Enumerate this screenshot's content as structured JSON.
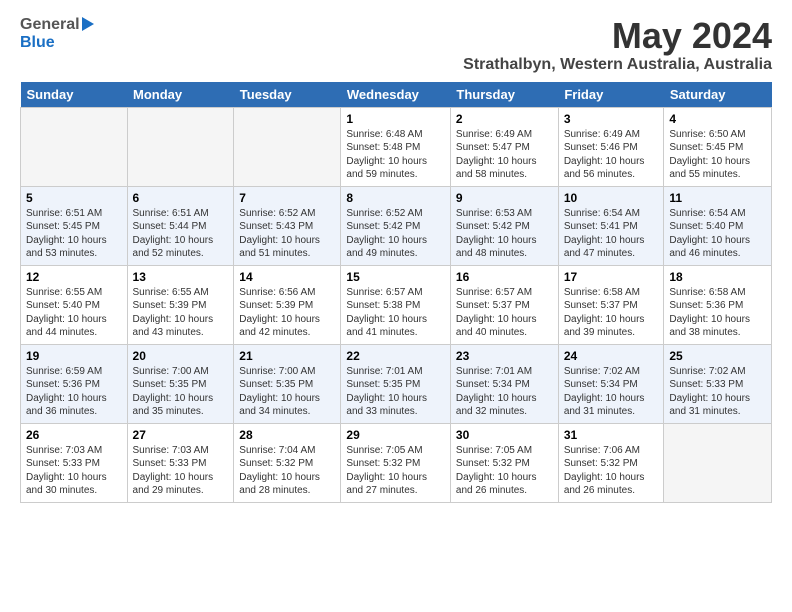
{
  "logo": {
    "general": "General",
    "blue": "Blue"
  },
  "title": "May 2024",
  "location": "Strathalbyn, Western Australia, Australia",
  "headers": [
    "Sunday",
    "Monday",
    "Tuesday",
    "Wednesday",
    "Thursday",
    "Friday",
    "Saturday"
  ],
  "rows": [
    [
      {
        "day": "",
        "content": ""
      },
      {
        "day": "",
        "content": ""
      },
      {
        "day": "",
        "content": ""
      },
      {
        "day": "1",
        "content": "Sunrise: 6:48 AM\nSunset: 5:48 PM\nDaylight: 10 hours\nand 59 minutes."
      },
      {
        "day": "2",
        "content": "Sunrise: 6:49 AM\nSunset: 5:47 PM\nDaylight: 10 hours\nand 58 minutes."
      },
      {
        "day": "3",
        "content": "Sunrise: 6:49 AM\nSunset: 5:46 PM\nDaylight: 10 hours\nand 56 minutes."
      },
      {
        "day": "4",
        "content": "Sunrise: 6:50 AM\nSunset: 5:45 PM\nDaylight: 10 hours\nand 55 minutes."
      }
    ],
    [
      {
        "day": "5",
        "content": "Sunrise: 6:51 AM\nSunset: 5:45 PM\nDaylight: 10 hours\nand 53 minutes."
      },
      {
        "day": "6",
        "content": "Sunrise: 6:51 AM\nSunset: 5:44 PM\nDaylight: 10 hours\nand 52 minutes."
      },
      {
        "day": "7",
        "content": "Sunrise: 6:52 AM\nSunset: 5:43 PM\nDaylight: 10 hours\nand 51 minutes."
      },
      {
        "day": "8",
        "content": "Sunrise: 6:52 AM\nSunset: 5:42 PM\nDaylight: 10 hours\nand 49 minutes."
      },
      {
        "day": "9",
        "content": "Sunrise: 6:53 AM\nSunset: 5:42 PM\nDaylight: 10 hours\nand 48 minutes."
      },
      {
        "day": "10",
        "content": "Sunrise: 6:54 AM\nSunset: 5:41 PM\nDaylight: 10 hours\nand 47 minutes."
      },
      {
        "day": "11",
        "content": "Sunrise: 6:54 AM\nSunset: 5:40 PM\nDaylight: 10 hours\nand 46 minutes."
      }
    ],
    [
      {
        "day": "12",
        "content": "Sunrise: 6:55 AM\nSunset: 5:40 PM\nDaylight: 10 hours\nand 44 minutes."
      },
      {
        "day": "13",
        "content": "Sunrise: 6:55 AM\nSunset: 5:39 PM\nDaylight: 10 hours\nand 43 minutes."
      },
      {
        "day": "14",
        "content": "Sunrise: 6:56 AM\nSunset: 5:39 PM\nDaylight: 10 hours\nand 42 minutes."
      },
      {
        "day": "15",
        "content": "Sunrise: 6:57 AM\nSunset: 5:38 PM\nDaylight: 10 hours\nand 41 minutes."
      },
      {
        "day": "16",
        "content": "Sunrise: 6:57 AM\nSunset: 5:37 PM\nDaylight: 10 hours\nand 40 minutes."
      },
      {
        "day": "17",
        "content": "Sunrise: 6:58 AM\nSunset: 5:37 PM\nDaylight: 10 hours\nand 39 minutes."
      },
      {
        "day": "18",
        "content": "Sunrise: 6:58 AM\nSunset: 5:36 PM\nDaylight: 10 hours\nand 38 minutes."
      }
    ],
    [
      {
        "day": "19",
        "content": "Sunrise: 6:59 AM\nSunset: 5:36 PM\nDaylight: 10 hours\nand 36 minutes."
      },
      {
        "day": "20",
        "content": "Sunrise: 7:00 AM\nSunset: 5:35 PM\nDaylight: 10 hours\nand 35 minutes."
      },
      {
        "day": "21",
        "content": "Sunrise: 7:00 AM\nSunset: 5:35 PM\nDaylight: 10 hours\nand 34 minutes."
      },
      {
        "day": "22",
        "content": "Sunrise: 7:01 AM\nSunset: 5:35 PM\nDaylight: 10 hours\nand 33 minutes."
      },
      {
        "day": "23",
        "content": "Sunrise: 7:01 AM\nSunset: 5:34 PM\nDaylight: 10 hours\nand 32 minutes."
      },
      {
        "day": "24",
        "content": "Sunrise: 7:02 AM\nSunset: 5:34 PM\nDaylight: 10 hours\nand 31 minutes."
      },
      {
        "day": "25",
        "content": "Sunrise: 7:02 AM\nSunset: 5:33 PM\nDaylight: 10 hours\nand 31 minutes."
      }
    ],
    [
      {
        "day": "26",
        "content": "Sunrise: 7:03 AM\nSunset: 5:33 PM\nDaylight: 10 hours\nand 30 minutes."
      },
      {
        "day": "27",
        "content": "Sunrise: 7:03 AM\nSunset: 5:33 PM\nDaylight: 10 hours\nand 29 minutes."
      },
      {
        "day": "28",
        "content": "Sunrise: 7:04 AM\nSunset: 5:32 PM\nDaylight: 10 hours\nand 28 minutes."
      },
      {
        "day": "29",
        "content": "Sunrise: 7:05 AM\nSunset: 5:32 PM\nDaylight: 10 hours\nand 27 minutes."
      },
      {
        "day": "30",
        "content": "Sunrise: 7:05 AM\nSunset: 5:32 PM\nDaylight: 10 hours\nand 26 minutes."
      },
      {
        "day": "31",
        "content": "Sunrise: 7:06 AM\nSunset: 5:32 PM\nDaylight: 10 hours\nand 26 minutes."
      },
      {
        "day": "",
        "content": ""
      }
    ]
  ]
}
